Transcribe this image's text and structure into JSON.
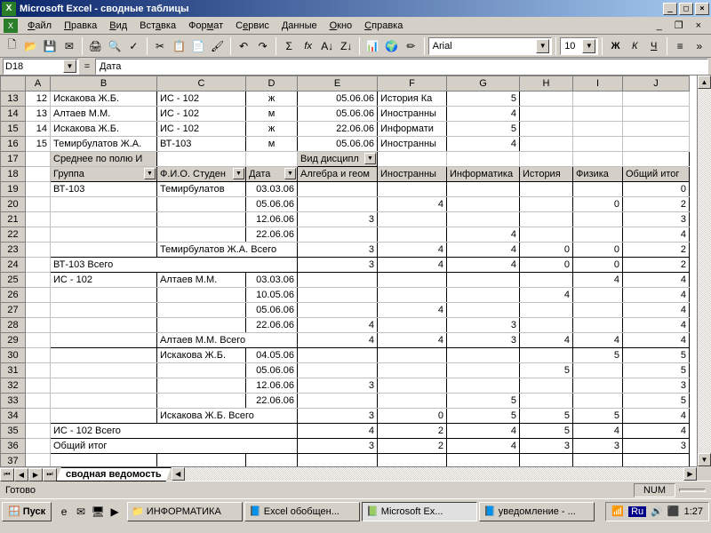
{
  "window": {
    "title": "Microsoft Excel - сводные таблицы"
  },
  "menu": [
    "Файл",
    "Правка",
    "Вид",
    "Вставка",
    "Формат",
    "Сервис",
    "Данные",
    "Окно",
    "Справка"
  ],
  "font": {
    "name": "Arial",
    "size": "10"
  },
  "formula": {
    "cell": "D18",
    "label": "Дата"
  },
  "cols": [
    "A",
    "B",
    "C",
    "D",
    "E",
    "F",
    "G",
    "H",
    "I",
    "J"
  ],
  "data_rows": [
    {
      "n": "13",
      "a": "12",
      "b": "Искакова Ж.Б.",
      "c": "ИС - 102",
      "d": "ж",
      "e": "05.06.06",
      "f": "История Ка",
      "g": "5"
    },
    {
      "n": "14",
      "a": "13",
      "b": "Алтаев М.М.",
      "c": "ИС - 102",
      "d": "м",
      "e": "05.06.06",
      "f": "Иностранны",
      "g": "4"
    },
    {
      "n": "15",
      "a": "14",
      "b": "Искакова Ж.Б.",
      "c": "ИС - 102",
      "d": "ж",
      "e": "22.06.06",
      "f": "Информати",
      "g": "5"
    },
    {
      "n": "16",
      "a": "15",
      "b": "Темирбулатов Ж.А.",
      "c": "ВТ-103",
      "d": "м",
      "e": "05.06.06",
      "f": "Иностранны",
      "g": "4"
    }
  ],
  "pivot": {
    "row17_b": "Среднее по полю И",
    "row17_e": "Вид дисципл",
    "hdr": {
      "grp": "Группа",
      "fio": "Ф.И.О. Студен",
      "date": "Дата",
      "e": "Алгебра и геом",
      "f": "Иностранны",
      "g": "Информатика",
      "h": "История",
      "i": "Физика",
      "j": "Общий итог"
    },
    "rows": [
      {
        "n": "19",
        "b": "ВТ-103",
        "c": "Темирбулатов",
        "d": "03.03.06",
        "j": "0"
      },
      {
        "n": "20",
        "d": "05.06.06",
        "f": "4",
        "i": "0",
        "j": "2"
      },
      {
        "n": "21",
        "d": "12.06.06",
        "e": "3",
        "j": "3"
      },
      {
        "n": "22",
        "d": "22.06.06",
        "g": "4",
        "j": "4"
      },
      {
        "n": "23",
        "c": "Темирбулатов Ж.А. Всего",
        "e": "3",
        "f": "4",
        "g": "4",
        "h": "0",
        "i": "0",
        "j": "2"
      },
      {
        "n": "24",
        "b": "ВТ-103 Всего",
        "e": "3",
        "f": "4",
        "g": "4",
        "h": "0",
        "i": "0",
        "j": "2"
      },
      {
        "n": "25",
        "b": "ИС - 102",
        "c": "Алтаев М.М.",
        "d": "03.03.06",
        "i": "4",
        "j": "4"
      },
      {
        "n": "26",
        "d": "10.05.06",
        "h": "4",
        "j": "4"
      },
      {
        "n": "27",
        "d": "05.06.06",
        "f": "4",
        "j": "4"
      },
      {
        "n": "28",
        "d": "22.06.06",
        "e": "4",
        "g": "3",
        "j": "4"
      },
      {
        "n": "29",
        "c": "Алтаев М.М. Всего",
        "e": "4",
        "f": "4",
        "g": "3",
        "h": "4",
        "i": "4",
        "j": "4"
      },
      {
        "n": "30",
        "c": "Искакова Ж.Б.",
        "d": "04.05.06",
        "i": "5",
        "j": "5"
      },
      {
        "n": "31",
        "d": "05.06.06",
        "h": "5",
        "j": "5"
      },
      {
        "n": "32",
        "d": "12.06.06",
        "e": "3",
        "j": "3"
      },
      {
        "n": "33",
        "d": "22.06.06",
        "g": "5",
        "j": "5"
      },
      {
        "n": "34",
        "c": "Искакова Ж.Б. Всего",
        "e": "3",
        "f": "0",
        "g": "5",
        "h": "5",
        "i": "5",
        "j": "4"
      },
      {
        "n": "35",
        "b": "ИС - 102 Всего",
        "e": "4",
        "f": "2",
        "g": "4",
        "h": "5",
        "i": "4",
        "j": "4"
      },
      {
        "n": "36",
        "b": "Общий итог",
        "e": "3",
        "f": "2",
        "g": "4",
        "h": "3",
        "i": "3",
        "j": "3"
      },
      {
        "n": "37"
      }
    ]
  },
  "sheet_tab": "сводная ведомость",
  "status": {
    "ready": "Готово",
    "num": "NUM"
  },
  "taskbar": {
    "start": "Пуск",
    "tasks": [
      {
        "icon": "📁",
        "label": "ИНФОРМАТИКА"
      },
      {
        "icon": "📘",
        "label": "Excel обобщен..."
      },
      {
        "icon": "📗",
        "label": "Microsoft Ex...",
        "active": true
      },
      {
        "icon": "📘",
        "label": "уведомление - ..."
      }
    ],
    "lang": "Ru",
    "time": "1:27"
  }
}
